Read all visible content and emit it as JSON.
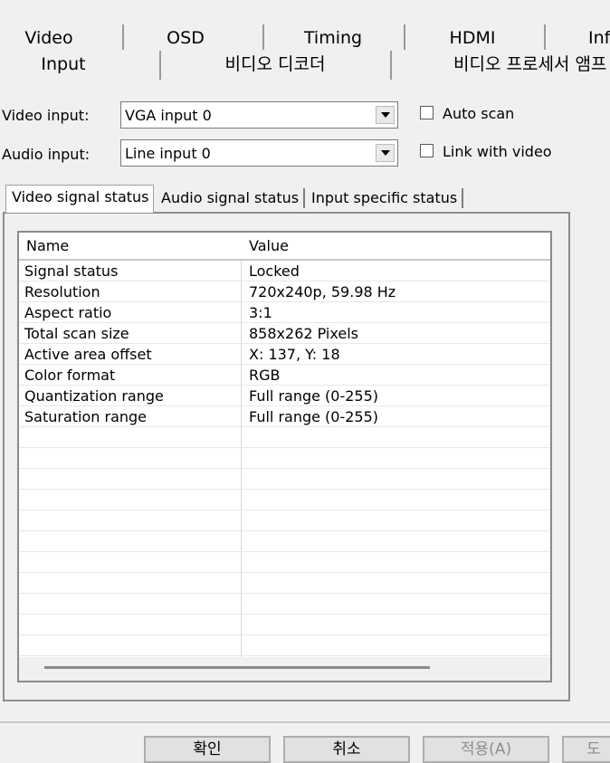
{
  "tabs_row1": [
    "Video",
    "OSD",
    "Timing",
    "HDMI",
    "Info"
  ],
  "tabs_row2": [
    "Input",
    "비디오 디코더",
    "비디오 프로세서 앰프"
  ],
  "form": {
    "video_input_label": "Video input:",
    "video_input_value": "VGA input 0",
    "audio_input_label": "Audio input:",
    "audio_input_value": "Line input 0",
    "auto_scan_label": "Auto scan",
    "link_video_label": "Link with video"
  },
  "inner_tabs": [
    "Video signal status",
    "Audio signal status",
    "Input specific status"
  ],
  "table": {
    "headers": [
      "Name",
      "Value"
    ],
    "rows": [
      [
        "Signal status",
        "Locked"
      ],
      [
        "Resolution",
        "720x240p, 59.98 Hz"
      ],
      [
        "Aspect ratio",
        "3:1"
      ],
      [
        "Total scan size",
        "858x262 Pixels"
      ],
      [
        "Active area offset",
        "X: 137, Y: 18"
      ],
      [
        "Color format",
        "RGB"
      ],
      [
        "Quantization range",
        "Full range (0-255)"
      ],
      [
        "Saturation range",
        "Full range (0-255)"
      ]
    ]
  },
  "buttons": {
    "ok": "확인",
    "cancel": "취소",
    "apply": "적용(A)",
    "more": "도"
  }
}
